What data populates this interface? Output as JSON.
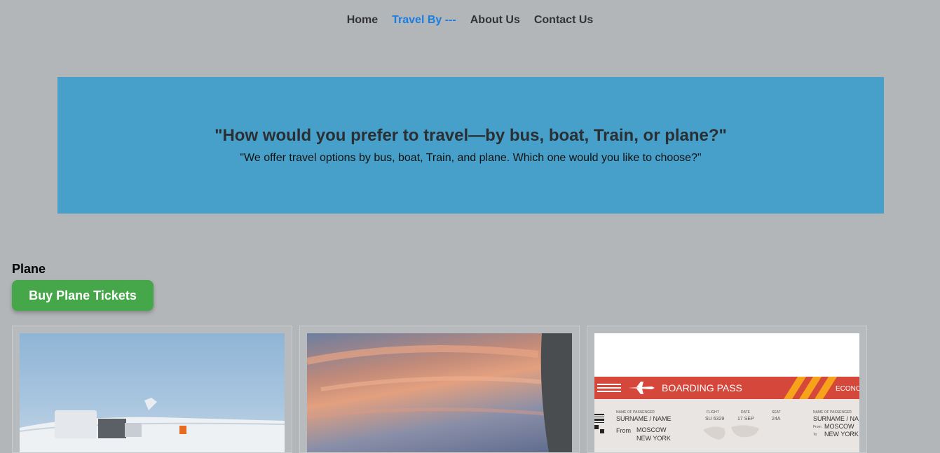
{
  "nav": {
    "items": [
      {
        "label": "Home",
        "active": false
      },
      {
        "label": "Travel By ---",
        "active": true
      },
      {
        "label": "About Us",
        "active": false
      },
      {
        "label": "Contact Us",
        "active": false
      }
    ],
    "active_color": "#1a7de0"
  },
  "hero": {
    "title": "\"How would you prefer to travel—by bus, boat, Train, or plane?\"",
    "subtitle": "\"We offer travel options by bus, boat, Train, and plane. Which one would you like to choose?\"",
    "background": "#46a0c9"
  },
  "section": {
    "title": "Plane",
    "button_label": "Buy Plane Tickets",
    "button_color": "#45a74a"
  },
  "ticket_card": {
    "header": "BOARDING PASS",
    "class_label": "ECONO",
    "name_label_1": "NAME OF PASSENGER",
    "name_value_1": "SURNAME / NAME",
    "flight_label": "FLIGHT",
    "flight_value": "SU 6329",
    "date_label": "DATE",
    "date_value": "17 SEP",
    "seat_label": "SEAT",
    "seat_value": "24A",
    "from_label": "From",
    "from_value": "MOSCOW",
    "to_value": "NEW YORK",
    "name_label_2": "NAME OF PASSENGER",
    "name_value_2": "SURNAME / NA",
    "from_label_2": "From",
    "from_value_2": "MOSCOW",
    "to_label_2": "To",
    "to_value_2": "NEW YORK"
  }
}
